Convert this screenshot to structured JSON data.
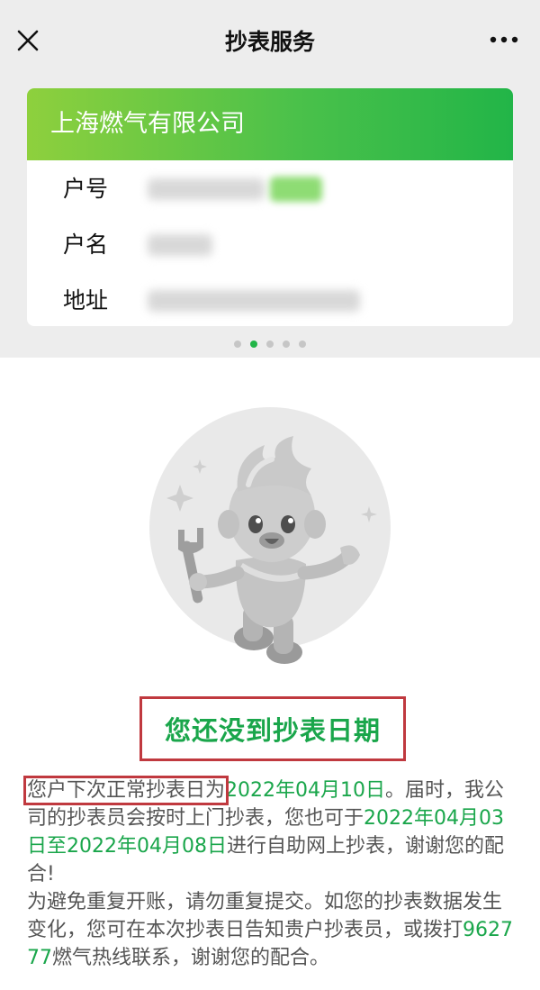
{
  "header": {
    "title": "抄表服务"
  },
  "account_card": {
    "company": "上海燃气有限公司",
    "rows": [
      {
        "label": "户号",
        "value_redacted": true
      },
      {
        "label": "户名",
        "value_redacted": true
      },
      {
        "label": "地址",
        "value_redacted": true
      }
    ],
    "pagination": {
      "total": 5,
      "active_index": 1
    }
  },
  "status": {
    "title": "您还没到抄表日期"
  },
  "info": {
    "p1_a": "您户下次正常抄表日为",
    "p1_date": "2022年04月10日",
    "p1_b": "。届时，我公司的抄表员会按时上门抄表，您也可于",
    "p1_range": "2022年04月03日至2022年04月08日",
    "p1_c": "进行自助网上抄表，谢谢您的配合!",
    "p2_a": "为避免重复开账，请勿重复提交。如您的抄表数据发生变化，您可在本次抄表日告知贵户抄表员，或拨打",
    "p2_phone": "962777",
    "p2_b": "燃气热线联系，谢谢您的配合。"
  },
  "colors": {
    "brand_green": "#22b548",
    "text_green": "#1aa64b",
    "highlight_red": "#c0393f"
  },
  "icons": [
    "close-icon",
    "more-icon",
    "sparkle-icon",
    "mascot-illustration"
  ]
}
